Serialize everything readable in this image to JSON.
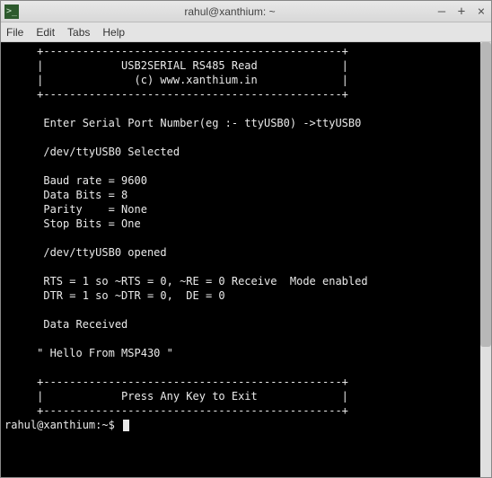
{
  "window": {
    "title": "rahul@xanthium: ~",
    "icon_glyph": ">_"
  },
  "menu": {
    "file": "File",
    "edit": "Edit",
    "tabs": "Tabs",
    "help": "Help"
  },
  "terminal": {
    "output": "     +----------------------------------------------+\n     |            USB2SERIAL RS485 Read             |\n     |              (c) www.xanthium.in             |\n     +----------------------------------------------+\n\n      Enter Serial Port Number(eg :- ttyUSB0) ->ttyUSB0\n\n      /dev/ttyUSB0 Selected\n\n      Baud rate = 9600\n      Data Bits = 8\n      Parity    = None\n      Stop Bits = One\n\n      /dev/ttyUSB0 opened\n\n      RTS = 1 so ~RTS = 0, ~RE = 0 Receive  Mode enabled\n      DTR = 1 so ~DTR = 0,  DE = 0\n\n      Data Received\n\n     \" Hello From MSP430 \"\n\n     +----------------------------------------------+\n     |            Press Any Key to Exit             |\n     +----------------------------------------------+\n",
    "prompt": "rahul@xanthium:~$ "
  }
}
